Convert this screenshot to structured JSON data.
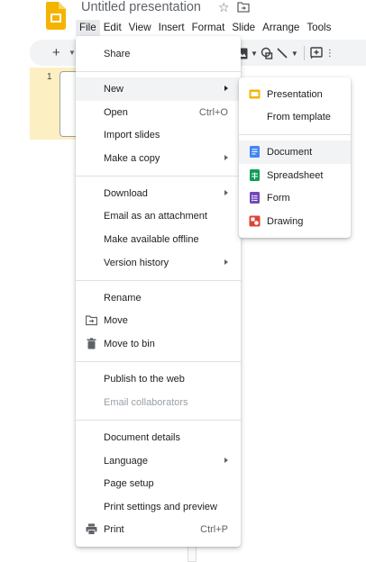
{
  "header": {
    "doc_title": "Untitled presentation",
    "icons": {
      "app": "slides-logo",
      "star": "star-icon",
      "move": "move-to-folder-icon"
    }
  },
  "menubar": {
    "items": [
      "File",
      "Edit",
      "View",
      "Insert",
      "Format",
      "Slide",
      "Arrange",
      "Tools"
    ],
    "active": "File"
  },
  "filmstrip": {
    "slide_number": "1"
  },
  "file_menu": {
    "items": {
      "share": "Share",
      "new": "New",
      "open": "Open",
      "open_shortcut": "Ctrl+O",
      "import_slides": "Import slides",
      "make_copy": "Make a copy",
      "download": "Download",
      "email_attachment": "Email as an attachment",
      "offline": "Make available offline",
      "version_history": "Version history",
      "rename": "Rename",
      "move": "Move",
      "move_to_bin": "Move to bin",
      "publish": "Publish to the web",
      "email_collaborators": "Email collaborators",
      "details": "Document details",
      "language": "Language",
      "page_setup": "Page setup",
      "print_settings": "Print settings and preview",
      "print": "Print",
      "print_shortcut": "Ctrl+P"
    }
  },
  "new_submenu": {
    "items": {
      "presentation": "Presentation",
      "from_template": "From template",
      "document": "Document",
      "spreadsheet": "Spreadsheet",
      "form": "Form",
      "drawing": "Drawing"
    },
    "highlighted": "Document"
  },
  "colors": {
    "slides_yellow": "#F4B400",
    "docs_blue": "#4285F4",
    "sheets_green": "#0F9D58",
    "forms_purple": "#7248B9",
    "drawings_red": "#DB4437",
    "menu_highlight": "#F1F3F4",
    "filmstrip_selected": "#FCEFC2"
  }
}
